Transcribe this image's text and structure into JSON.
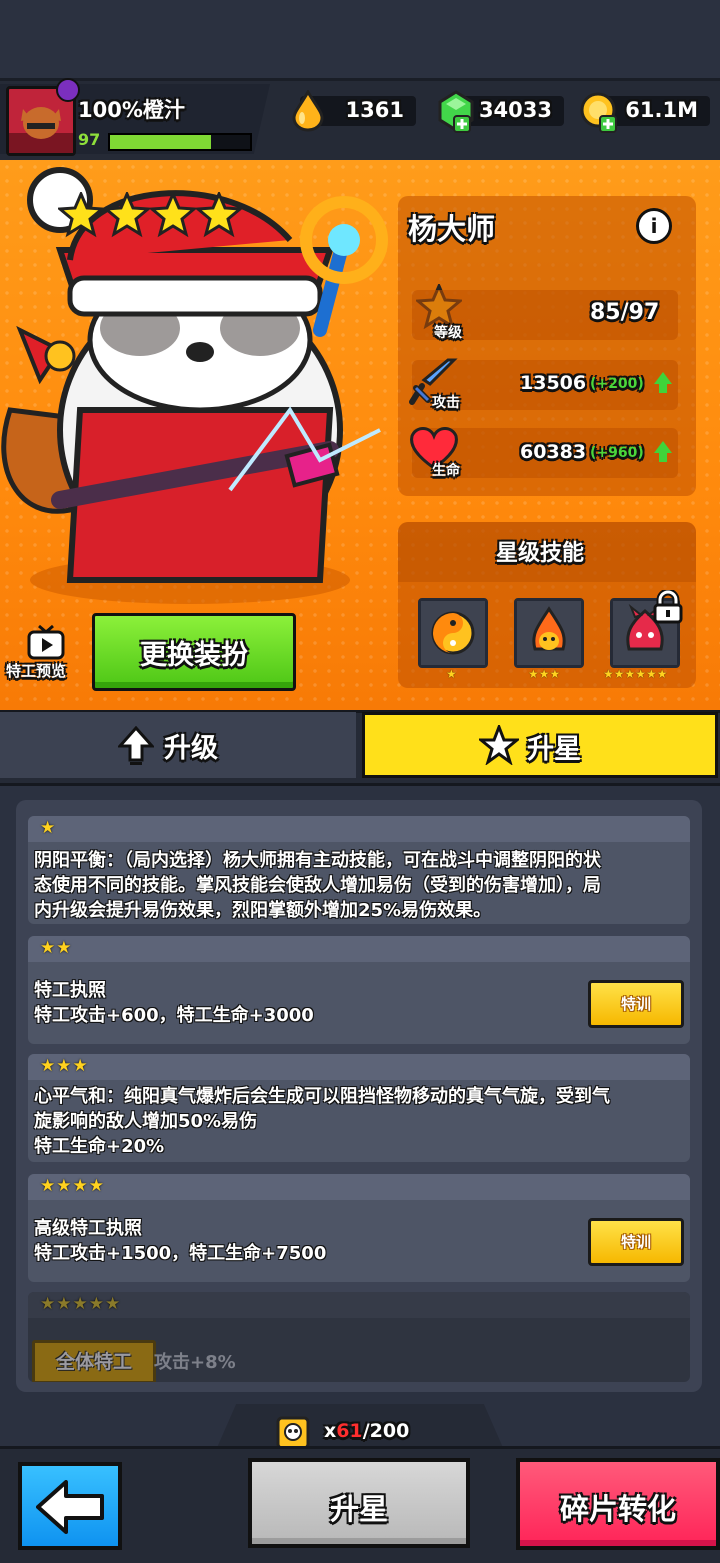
{
  "player": {
    "name": "100%橙汁",
    "level": "97",
    "exp_fraction": 0.72
  },
  "resources": [
    {
      "icon": "water-drop-icon",
      "value": "1361"
    },
    {
      "icon": "green-gem-icon",
      "value": "34033"
    },
    {
      "icon": "gold-coin-icon",
      "value": "61.1M"
    }
  ],
  "hero": {
    "name": "杨大师",
    "star_count": 4,
    "stats": {
      "level_label": "等级",
      "level_value": "85/97",
      "attack_label": "攻击",
      "attack_value": "13506",
      "attack_bonus": "(+200)",
      "hp_label": "生命",
      "hp_value": "60383",
      "hp_bonus": "(+960)"
    },
    "skills_title": "星级技能",
    "skills": [
      {
        "icon": "yin-yang-icon",
        "stars": "★"
      },
      {
        "icon": "flame-spirit-icon",
        "stars": "★★★"
      },
      {
        "icon": "red-demon-icon",
        "stars": "★★★★★★",
        "locked": true
      }
    ],
    "preview_label": "特工预览",
    "change_skin_label": "更换装扮"
  },
  "tabs": [
    {
      "label": "升级",
      "active": false
    },
    {
      "label": "升星",
      "active": true
    }
  ],
  "star_rewards": [
    {
      "stars": "★",
      "lines": [
        "阴阳平衡：（局内选择）杨大师拥有主动技能，可在战斗中调整阴阳的状",
        "态使用不同的技能。掌风技能会使敌人增加易伤（受到的伤害增加），局",
        "内升级会提升易伤效果，烈阳掌额外增加25%易伤效果。"
      ]
    },
    {
      "stars": "★★",
      "lines": [
        "特工执照",
        "特工攻击+600，特工生命+3000"
      ],
      "button": "特训"
    },
    {
      "stars": "★★★",
      "lines": [
        "心平气和：纯阳真气爆炸后会生成可以阻挡怪物移动的真气气旋，受到气",
        "旋影响的敌人增加50%易伤",
        "特工生命+20%"
      ]
    },
    {
      "stars": "★★★★",
      "lines": [
        "高级特工执照",
        "特工攻击+1500，特工生命+7500"
      ],
      "button": "特训"
    },
    {
      "stars": "★★★★★",
      "tag": "全体特工",
      "text": "攻击+8%"
    }
  ],
  "fragments": {
    "prefix": "x",
    "current": "61",
    "total": "/200"
  },
  "buttons": {
    "star_up": "升星",
    "convert": "碎片转化"
  },
  "colors": {
    "accent_orange": "#ff9c1a",
    "active_tab": "#ffe01a",
    "convert_red": "#ff2e5e",
    "back_blue": "#1ba8ff"
  }
}
